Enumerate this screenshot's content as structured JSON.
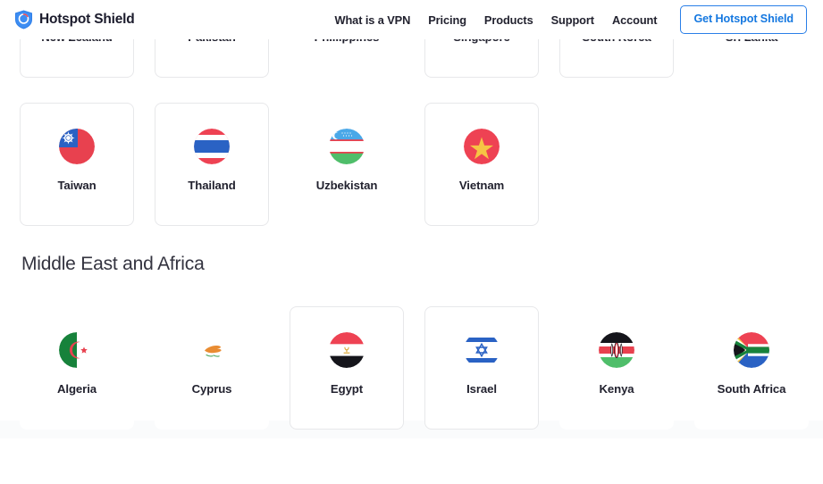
{
  "header": {
    "brand": {
      "name": "Hotspot Shield",
      "icon": "shield-logo-icon"
    },
    "nav": [
      {
        "label": "What is a VPN",
        "name": "nav-what-is-a-vpn"
      },
      {
        "label": "Pricing",
        "name": "nav-pricing"
      },
      {
        "label": "Products",
        "name": "nav-products"
      },
      {
        "label": "Support",
        "name": "nav-support"
      },
      {
        "label": "Account",
        "name": "nav-account"
      }
    ],
    "cta_label": "Get Hotspot Shield",
    "accent_color": "#1578e0",
    "text_color": "#22222f"
  },
  "sections": [
    {
      "heading": null,
      "rows": [
        {
          "name": "country-row-asia-1",
          "cards": [
            {
              "label": "New Zealand",
              "flag": "flag-new-zealand",
              "bordered": true
            },
            {
              "label": "Pakistan",
              "flag": "flag-pakistan",
              "bordered": true
            },
            {
              "label": "Phillippines",
              "flag": "flag-philippines",
              "bordered": false
            },
            {
              "label": "Singapore",
              "flag": "flag-singapore",
              "bordered": true
            },
            {
              "label": "South Korea",
              "flag": "flag-south-korea",
              "bordered": true
            },
            {
              "label": "Sri Lanka",
              "flag": "flag-sri-lanka",
              "bordered": false
            }
          ]
        },
        {
          "name": "country-row-asia-2",
          "cards": [
            {
              "label": "Taiwan",
              "flag": "flag-taiwan",
              "bordered": true
            },
            {
              "label": "Thailand",
              "flag": "flag-thailand",
              "bordered": true
            },
            {
              "label": "Uzbekistan",
              "flag": "flag-uzbekistan",
              "bordered": false
            },
            {
              "label": "Vietnam",
              "flag": "flag-vietnam",
              "bordered": true
            }
          ]
        }
      ]
    },
    {
      "heading": "Middle East and Africa",
      "rows": [
        {
          "name": "country-row-mea-1",
          "cards": [
            {
              "label": "Algeria",
              "flag": "flag-algeria",
              "bordered": false
            },
            {
              "label": "Cyprus",
              "flag": "flag-cyprus",
              "bordered": false
            },
            {
              "label": "Egypt",
              "flag": "flag-egypt",
              "bordered": true
            },
            {
              "label": "Israel",
              "flag": "flag-israel",
              "bordered": true
            },
            {
              "label": "Kenya",
              "flag": "flag-kenya",
              "bordered": false
            },
            {
              "label": "South Africa",
              "flag": "flag-south-africa",
              "bordered": false
            }
          ]
        }
      ]
    }
  ]
}
